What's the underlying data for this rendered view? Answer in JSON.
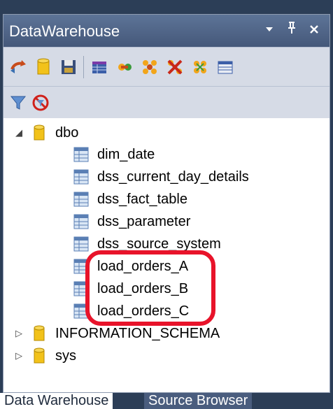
{
  "window": {
    "title": "DataWarehouse",
    "controls": [
      "dropdown-icon",
      "pin-icon",
      "close-icon"
    ]
  },
  "toolbar_row1": [
    "refresh-icon",
    "database-icon",
    "save-icon",
    "table-icon",
    "relationship-icon",
    "join-icon",
    "remove-join-icon",
    "link-icon",
    "grid-icon"
  ],
  "toolbar_row2": [
    "filter-icon",
    "clear-filter-icon"
  ],
  "tree": {
    "root": {
      "label": "dbo",
      "expanded": true
    },
    "children": [
      {
        "label": "dim_date"
      },
      {
        "label": "dss_current_day_details"
      },
      {
        "label": "dss_fact_table"
      },
      {
        "label": "dss_parameter"
      },
      {
        "label": "dss_source_system"
      },
      {
        "label": "load_orders_A"
      },
      {
        "label": "load_orders_B"
      },
      {
        "label": "load_orders_C"
      }
    ],
    "others": [
      {
        "label": "INFORMATION_SCHEMA",
        "expanded": false
      },
      {
        "label": "sys",
        "expanded": false
      }
    ]
  },
  "tabs": {
    "active": "Data Warehouse",
    "inactive": "Source Browser"
  },
  "colors": {
    "title_bar": "#4f6488",
    "toolbar": "#d6dbe6",
    "highlight": "#e8132a",
    "frame": "#2c3e57"
  }
}
